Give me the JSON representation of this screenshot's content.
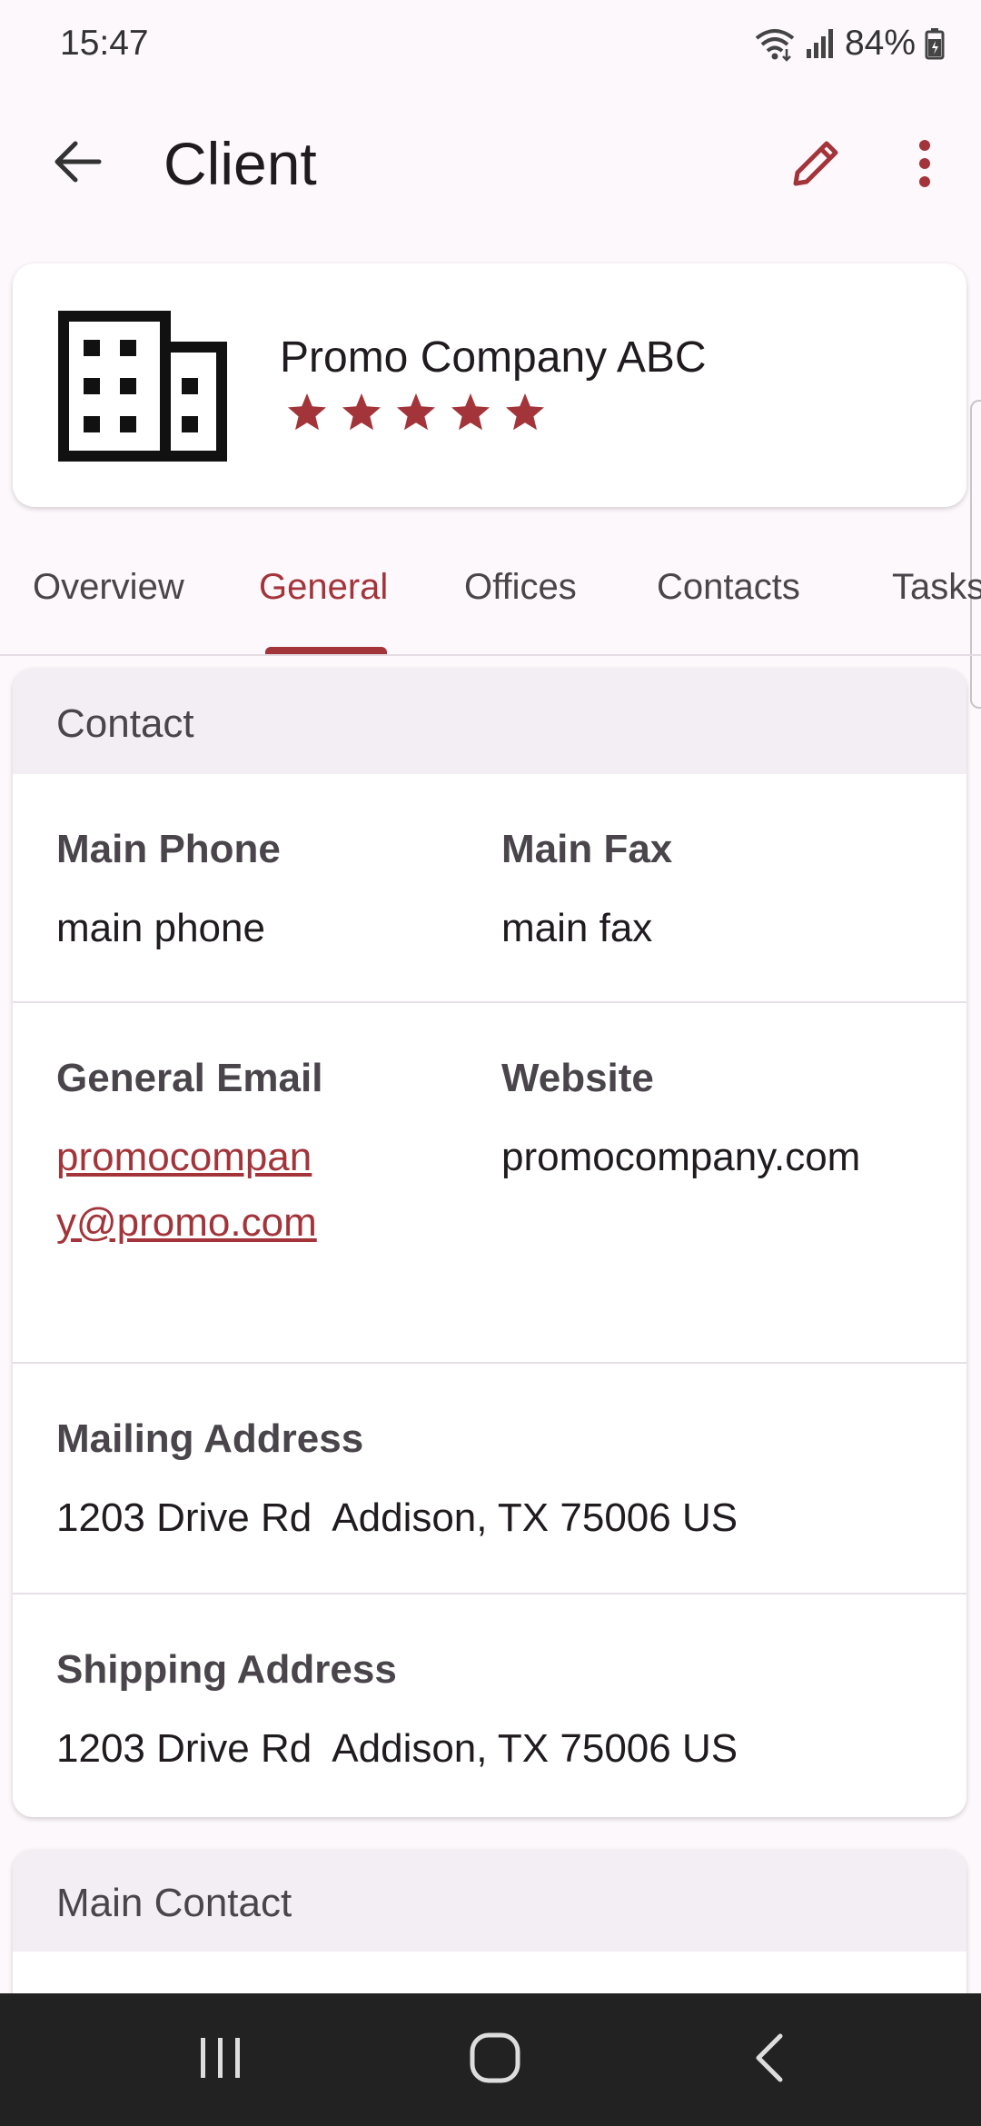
{
  "status_bar": {
    "time": "15:47",
    "battery": "84%"
  },
  "app_bar": {
    "title": "Client"
  },
  "client": {
    "name": "Promo Company ABC",
    "rating": 5,
    "rating_max": 5
  },
  "tabs": [
    {
      "label": "Overview"
    },
    {
      "label": "General"
    },
    {
      "label": "Offices"
    },
    {
      "label": "Contacts"
    },
    {
      "label": "Tasks"
    }
  ],
  "contact_section": {
    "title": "Contact",
    "main_phone": {
      "label": "Main Phone",
      "value": "main phone"
    },
    "main_fax": {
      "label": "Main Fax",
      "value": "main fax"
    },
    "general_email": {
      "label": "General Email",
      "value": "promocompany@promo.com"
    },
    "website": {
      "label": "Website",
      "value": "promocompany.com"
    },
    "mailing_address": {
      "label": "Mailing Address",
      "value": "1203 Drive Rd  Addison, TX 75006 US"
    },
    "shipping_address": {
      "label": "Shipping Address",
      "value": "1203 Drive Rd  Addison, TX 75006 US"
    }
  },
  "main_contact_section": {
    "title": "Main Contact"
  },
  "colors": {
    "accent": "#a3343a",
    "background": "#fdf8fc",
    "card_header": "#f2eef3",
    "nav_bar": "#222222"
  },
  "icons": {
    "back": "arrow-left-icon",
    "edit": "pencil-icon",
    "more": "more-vert-icon",
    "client": "building-icon",
    "rating": "star-icon"
  }
}
